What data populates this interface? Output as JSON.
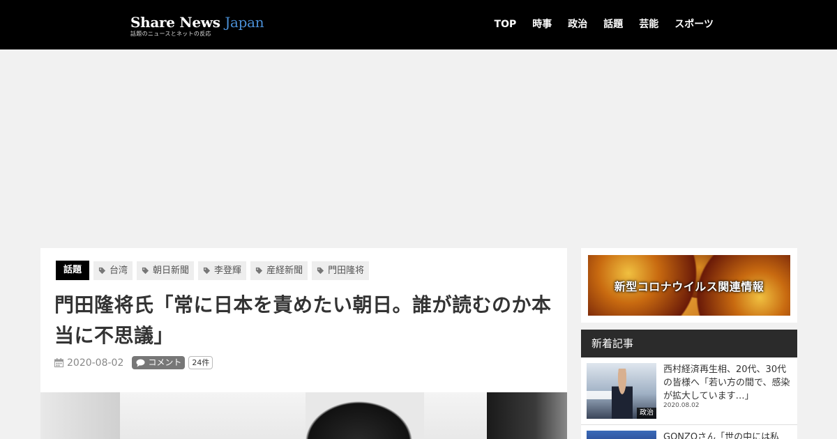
{
  "header": {
    "logo_main": "Share News",
    "logo_accent": "Japan",
    "logo_sub": "話題のニュースとネットの反応",
    "nav": [
      "TOP",
      "時事",
      "政治",
      "話題",
      "芸能",
      "スポーツ"
    ]
  },
  "article": {
    "category": "話題",
    "tags": [
      "台湾",
      "朝日新聞",
      "李登輝",
      "産経新聞",
      "門田隆将"
    ],
    "title": "門田隆将氏「常に日本を責めたい朝日。誰が読むのか本当に不思議」",
    "date": "2020-08-02",
    "comment_label": "コメント",
    "comment_count": "24件"
  },
  "sidebar": {
    "banner_text": "新型コロナウイルス関連情報",
    "news_heading": "新着記事",
    "news": [
      {
        "title": "西村経済再生相、20代、30代の皆様へ「若い方の間で、感染が拡大しています…」",
        "date": "2020.08.02",
        "category": "政治"
      },
      {
        "title": "GONZOさん「世の中には私の…",
        "date": "",
        "category": ""
      }
    ]
  },
  "colors": {
    "header_bg": "#000000",
    "logo_accent": "#4a8fd6",
    "side_head_bg": "#2b2b2b"
  }
}
